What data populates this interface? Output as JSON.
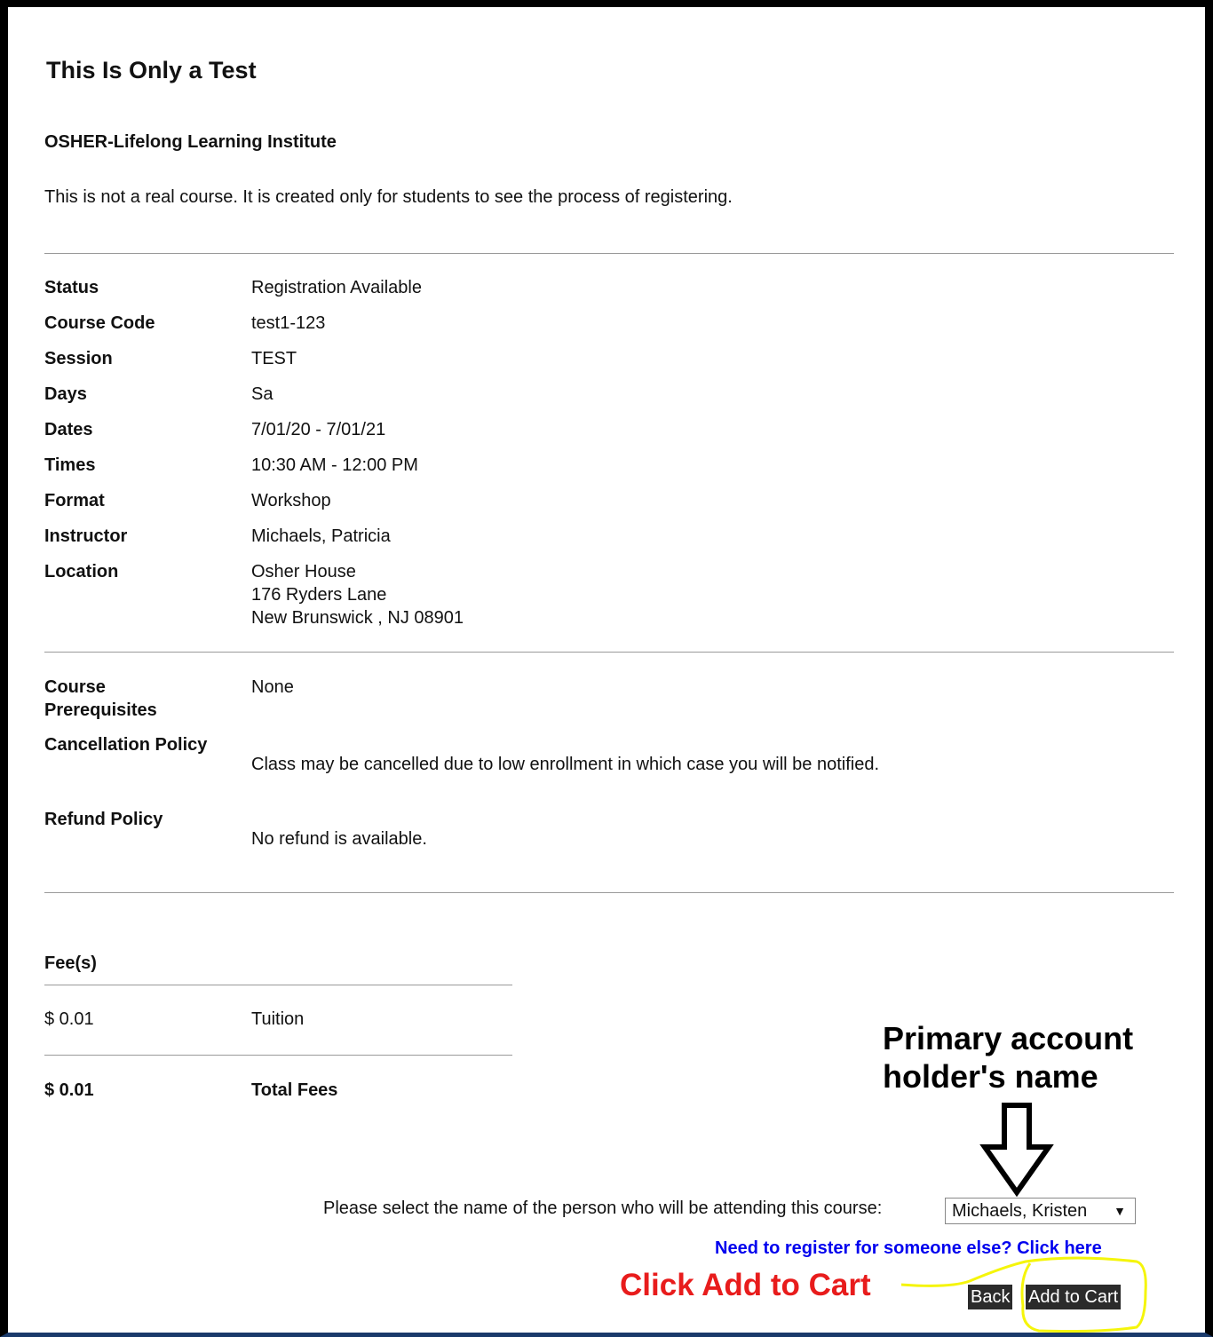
{
  "course": {
    "title": "This Is Only a Test",
    "organization": "OSHER-Lifelong Learning Institute",
    "description": "This is not a real course. It is created only for students to see the process of registering."
  },
  "details": {
    "status_label": "Status",
    "status": "Registration Available",
    "code_label": "Course Code",
    "code": "test1-123",
    "session_label": "Session",
    "session": "TEST",
    "days_label": "Days",
    "days": "Sa",
    "dates_label": "Dates",
    "dates": "7/01/20 - 7/01/21",
    "times_label": "Times",
    "times": "10:30 AM - 12:00 PM",
    "format_label": "Format",
    "format": "Workshop",
    "instructor_label": "Instructor",
    "instructor": "Michaels, Patricia",
    "location_label": "Location",
    "location_line1": "Osher House",
    "location_line2": "176 Ryders Lane",
    "location_line3": "New Brunswick , NJ 08901"
  },
  "policies": {
    "prereq_label_line1": "Course",
    "prereq_label_line2": "Prerequisites",
    "prereq": "None",
    "cancel_label": "Cancellation Policy",
    "cancel": "Class may be cancelled due to low enrollment in which case you will be notified.",
    "refund_label": "Refund Policy",
    "refund": "No refund is available."
  },
  "fees": {
    "header": "Fee(s)",
    "items": [
      {
        "amount": "$ 0.01",
        "name": "Tuition"
      }
    ],
    "total_amount": "$ 0.01",
    "total_label": "Total Fees"
  },
  "registration": {
    "prompt": "Please select the name of the person who will be attending this course:",
    "selected_person": "Michaels, Kristen",
    "other_link": "Need to register for someone else? Click here",
    "back_label": "Back",
    "add_label": "Add to Cart"
  },
  "annotations": {
    "primary_line1": "Primary account",
    "primary_line2": "holder's name",
    "click_note": "Click Add to Cart",
    "highlight_color": "#f5f50a",
    "click_note_color": "#e81c1c"
  }
}
